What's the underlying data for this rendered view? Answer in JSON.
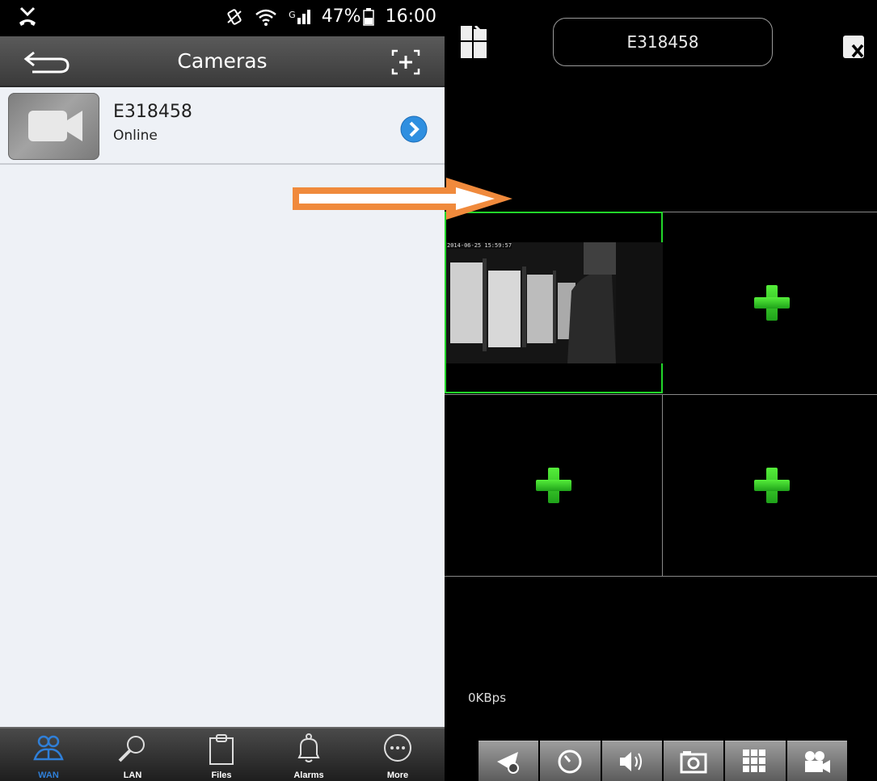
{
  "status_bar": {
    "time": "16:00",
    "battery": "47%",
    "network_label": "G"
  },
  "header": {
    "title": "Cameras"
  },
  "camera_list": [
    {
      "name": "E318458",
      "status": "Online"
    }
  ],
  "bottom_tabs": [
    {
      "label": "WAN",
      "icon": "people-icon",
      "active": true
    },
    {
      "label": "LAN",
      "icon": "search-icon",
      "active": false
    },
    {
      "label": "Files",
      "icon": "clipboard-icon",
      "active": false
    },
    {
      "label": "Alarms",
      "icon": "bell-icon",
      "active": false
    },
    {
      "label": "More",
      "icon": "more-icon",
      "active": false
    }
  ],
  "live_view": {
    "device_name": "E318458",
    "timestamp": "2014-06-25 15:59:57",
    "bitrate": "0KBps",
    "toolbar_icons": [
      "ptz-settings-icon",
      "speed-icon",
      "speaker-icon",
      "camera-snapshot-icon",
      "grid-layout-icon",
      "record-icon"
    ]
  },
  "colors": {
    "accent_blue": "#2f7fd8",
    "selected_border": "#22d62a",
    "plus_green": "#3cd62e",
    "arrow_orange": "#f08a3c"
  }
}
